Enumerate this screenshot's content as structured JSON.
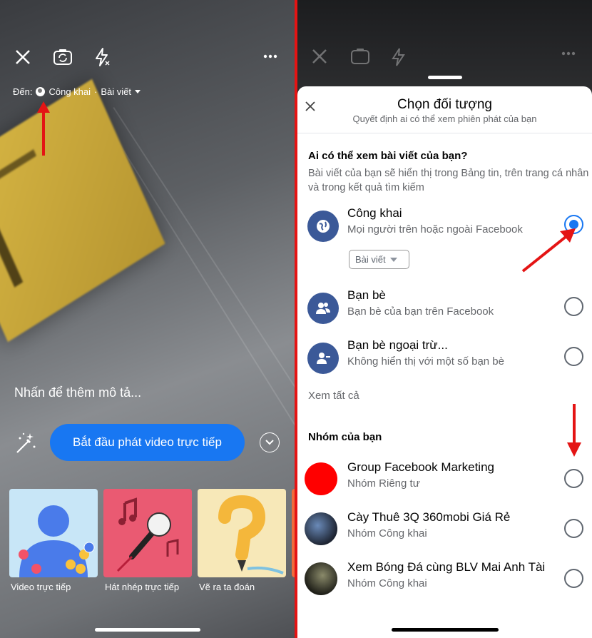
{
  "left": {
    "to_prefix": "Đến:",
    "audience": "Công khai",
    "post_type": "Bài viết",
    "description_placeholder": "Nhấn để thêm mô tả...",
    "go_live_label": "Bắt đầu phát video trực tiếp",
    "cards": [
      {
        "label": "Video trực tiếp",
        "bg": "#c8e6f7"
      },
      {
        "label": "Hát nhép trực tiếp",
        "bg": "#ea5a72"
      },
      {
        "label": "Vẽ ra ta đoán",
        "bg": "#f7e8b8"
      }
    ]
  },
  "sheet": {
    "title": "Chọn đối tượng",
    "subtitle": "Quyết định ai có thể xem phiên phát của bạn",
    "section_title": "Ai có thể xem bài viết của bạn?",
    "section_desc": "Bài viết của bạn sẽ hiển thị trong Bảng tin, trên trang cá nhân và trong kết quả tìm kiếm",
    "options": [
      {
        "title": "Công khai",
        "subtitle": "Mọi người trên hoặc ngoài Facebook",
        "selected": true,
        "icon": "globe-icon"
      },
      {
        "title": "Bạn bè",
        "subtitle": "Bạn bè của bạn trên Facebook",
        "selected": false,
        "icon": "friends-icon"
      },
      {
        "title": "Bạn bè ngoại trừ...",
        "subtitle": "Không hiển thị với một số bạn bè",
        "selected": false,
        "icon": "friends-except-icon"
      }
    ],
    "post_type_chip": "Bài viết",
    "see_all": "Xem tất cả",
    "groups_title": "Nhóm của bạn",
    "groups": [
      {
        "title": "Group Facebook Marketing",
        "subtitle": "Nhóm Riêng tư",
        "avatar_color": "#ff0000"
      },
      {
        "title": "Cày Thuê 3Q 360mobi Giá Rẻ",
        "subtitle": "Nhóm Công khai",
        "avatar_color": "#2a3040"
      },
      {
        "title": "Xem Bóng Đá cùng BLV Mai Anh Tài",
        "subtitle": "Nhóm Công khai",
        "avatar_color": "#3a3a2a"
      }
    ]
  },
  "colors": {
    "brand_blue": "#1877f2",
    "annotation_red": "#e41414",
    "icon_blue": "#3b5998"
  }
}
